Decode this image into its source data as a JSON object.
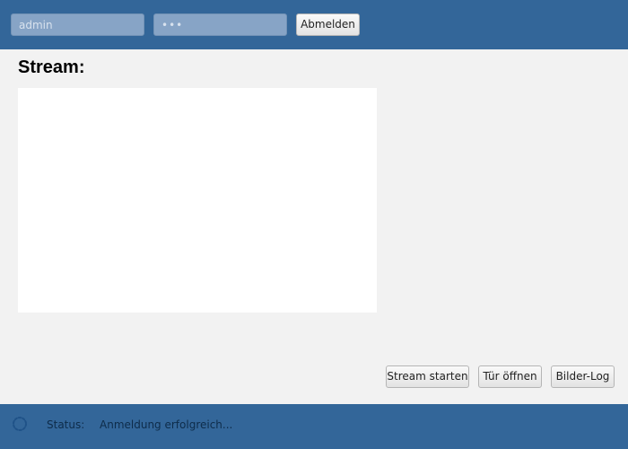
{
  "login": {
    "username_value": "admin",
    "password_value": "•••",
    "logout_label": "Abmelden"
  },
  "stream": {
    "title": "Stream:"
  },
  "actions": {
    "start_stream_label": "Stream starten",
    "open_door_label": "Tür öffnen",
    "image_log_label": "Bilder-Log"
  },
  "status": {
    "label": "Status:",
    "message": "Anmeldung erfolgreich..."
  },
  "colors": {
    "bar": "#336699",
    "background": "#f2f2f2",
    "stream_area": "#ffffff"
  },
  "icons": {
    "status_indicator": "loading-spinner-icon"
  }
}
